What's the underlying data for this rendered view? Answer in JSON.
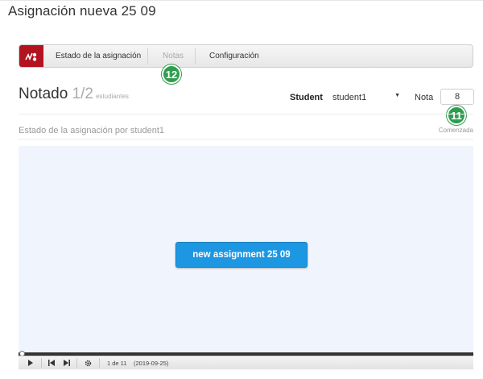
{
  "page": {
    "title": "Asignación nueva 25 09"
  },
  "toolbar": {
    "logo_icon": "app-logo-icon",
    "tabs": [
      {
        "label": "Estado de la asignación",
        "active": false
      },
      {
        "label": "Notas",
        "active": true
      },
      {
        "label": "Configuración",
        "active": false
      }
    ]
  },
  "badges": {
    "notes_tab": "12",
    "grade_field": "11",
    "color": "#2f9d4f"
  },
  "grading": {
    "heading": "Notado",
    "count": "1/2",
    "count_unit": "estudiantes",
    "student_label": "Student",
    "student_value": "student1",
    "grade_label": "Nota",
    "grade_value": "8"
  },
  "status": {
    "title": "Estado de la asignación por student1",
    "value": "Comenzada"
  },
  "viewer": {
    "button_label": "new assignment 25 09",
    "button_color": "#1e97e3",
    "progress": 0.0
  },
  "player": {
    "frame": "1 de 11",
    "date": "(2019-09-25)"
  }
}
